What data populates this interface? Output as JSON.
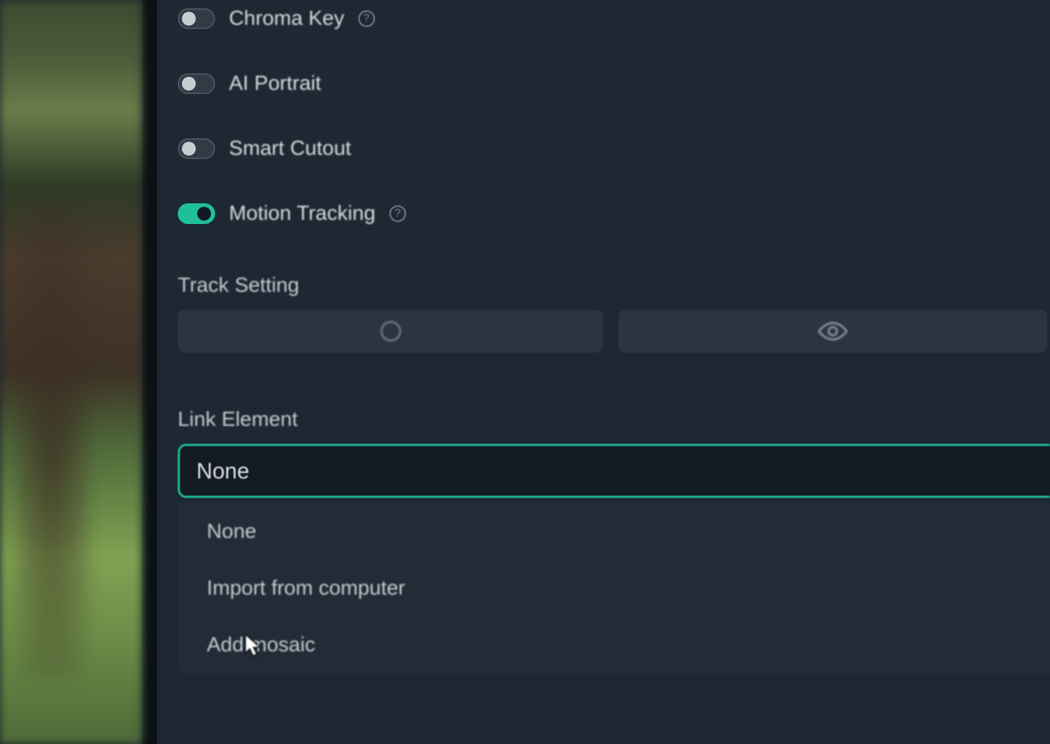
{
  "panel": {
    "toggles": [
      {
        "label": "Chroma Key",
        "on": false,
        "help": true
      },
      {
        "label": "AI Portrait",
        "on": false,
        "help": false
      },
      {
        "label": "Smart Cutout",
        "on": false,
        "help": false
      },
      {
        "label": "Motion Tracking",
        "on": true,
        "help": true
      }
    ],
    "track_setting_label": "Track Setting",
    "link_element_label": "Link Element",
    "link_element_selected": "None",
    "link_element_options": [
      "None",
      "Import from computer",
      "Add mosaic"
    ]
  }
}
